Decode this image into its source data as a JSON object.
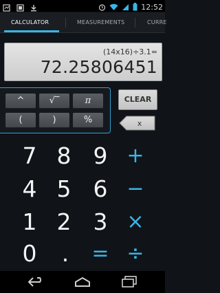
{
  "status": {
    "time": "12:52"
  },
  "tabs": [
    {
      "label": "CALCULATOR",
      "active": true
    },
    {
      "label": "MEASUREMENTS",
      "active": false
    },
    {
      "label": "CURRE",
      "active": false
    }
  ],
  "display": {
    "expression": "(14x16)÷3.1=",
    "result": "72.25806451"
  },
  "functions": {
    "power": "^",
    "sqrt": "√‾",
    "pi": "π",
    "open_paren": "(",
    "close_paren": ")",
    "percent": "%"
  },
  "controls": {
    "clear": "CLEAR",
    "backspace_mark": "x"
  },
  "keys": {
    "row1": [
      "7",
      "8",
      "9"
    ],
    "row2": [
      "4",
      "5",
      "6"
    ],
    "row3": [
      "1",
      "2",
      "3"
    ],
    "row4": [
      "0",
      "."
    ],
    "plus": "+",
    "minus": "−",
    "times": "×",
    "divide": "÷",
    "equals": "="
  },
  "colors": {
    "accent": "#3ab4e6",
    "background": "#101317"
  },
  "icons": [
    "notification-icon",
    "screenshot-icon",
    "download-icon",
    "alarm-icon",
    "wifi-icon",
    "signal-icon",
    "battery-icon",
    "back-icon",
    "home-icon",
    "recent-apps-icon"
  ]
}
